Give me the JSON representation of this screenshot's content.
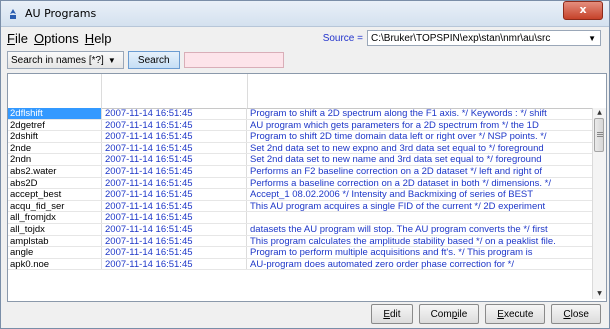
{
  "window": {
    "title": "AU Programs",
    "close_glyph": "x"
  },
  "menu": [
    {
      "u": "F",
      "rest": "ile"
    },
    {
      "u": "O",
      "rest": "ptions"
    },
    {
      "u": "H",
      "rest": "elp"
    }
  ],
  "source": {
    "label": "Source =",
    "value": "C:\\Bruker\\TOPSPIN\\exp\\stan\\nmr\\au\\src"
  },
  "search": {
    "mode": "Search in names [*?]",
    "button": "Search",
    "value": ""
  },
  "table": {
    "rows": [
      {
        "name": "2dflshift",
        "date": "2007-11-14 16:51:45",
        "desc": "Program to shift a 2D spectrum along the F1 axis. */ Keywords : */ shift",
        "selected": true
      },
      {
        "name": "2dgetref",
        "date": "2007-11-14 16:51:45",
        "desc": "AU program which gets parameters for a 2D spectrum from */ the 1D"
      },
      {
        "name": "2dshift",
        "date": "2007-11-14 16:51:45",
        "desc": "Program to shift 2D time domain data left or right over */ NSP points. */"
      },
      {
        "name": "2nde",
        "date": "2007-11-14 16:51:45",
        "desc": "Set 2nd data set to new expno and 3rd data set equal to */ foreground"
      },
      {
        "name": "2ndn",
        "date": "2007-11-14 16:51:45",
        "desc": "Set 2nd data set to new name and 3rd data set equal to */ foreground"
      },
      {
        "name": "abs2.water",
        "date": "2007-11-14 16:51:45",
        "desc": "Performs an F2 baseline correction on a 2D dataset */ left and right of"
      },
      {
        "name": "abs2D",
        "date": "2007-11-14 16:51:45",
        "desc": "Performs a baseline correction on a 2D dataset in both */ dimensions. */"
      },
      {
        "name": "accept_best",
        "date": "2007-11-14 16:51:45",
        "desc": "Accept_1 08.02.2006 */ Intensity and Backmixing of series of BEST"
      },
      {
        "name": "acqu_fid_ser",
        "date": "2007-11-14 16:51:45",
        "desc": "This AU program acquires a single FID of the current */ 2D experiment"
      },
      {
        "name": "all_fromjdx",
        "date": "2007-11-14 16:51:45",
        "desc": ""
      },
      {
        "name": "all_tojdx",
        "date": "2007-11-14 16:51:45",
        "desc": "datasets the AU program will stop. The AU program converts the */ first"
      },
      {
        "name": "amplstab",
        "date": "2007-11-14 16:51:45",
        "desc": "This program calculates the amplitude stability based */ on a peaklist file."
      },
      {
        "name": "angle",
        "date": "2007-11-14 16:51:45",
        "desc": "Program to perform multiple acquisitions and ft's. */ This program is"
      },
      {
        "name": "apk0.noe",
        "date": "2007-11-14 16:51:45",
        "desc": "AU-program does automated zero order phase correction for */"
      }
    ]
  },
  "buttons": [
    {
      "u": "E",
      "rest": "dit",
      "pre": ""
    },
    {
      "pre": "Com",
      "u": "p",
      "rest": "ile"
    },
    {
      "u": "E",
      "rest": "xecute",
      "pre": ""
    },
    {
      "u": "C",
      "rest": "lose",
      "pre": ""
    }
  ]
}
